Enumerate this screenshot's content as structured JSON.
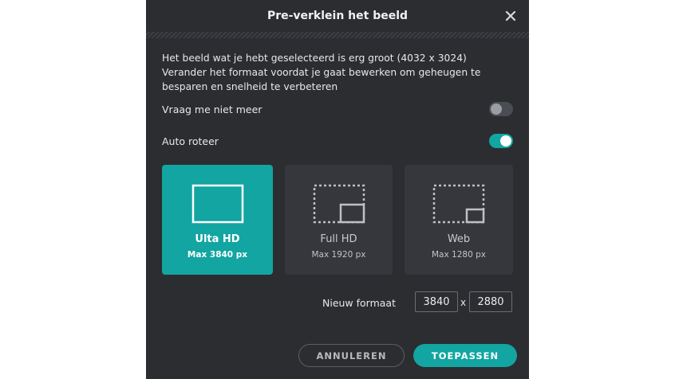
{
  "dialog": {
    "title": "Pre-verklein het beeld",
    "close_icon": "close-icon",
    "description": "Het beeld wat je hebt geselecteerd is erg groot (4032 x 3024) Verander het formaat voordat je gaat bewerken om geheugen te besparen en snelheid te verbeteren",
    "description_lines": [
      "Het beeld wat je hebt geselecteerd is erg groot (4032 x 3024)",
      "Verander het formaat voordat je gaat bewerken om geheugen te",
      "besparen en snelheid te verbeteren"
    ]
  },
  "options": {
    "dont_ask_label": "Vraag me niet meer",
    "dont_ask_on": false,
    "auto_rotate_label": "Auto roteer",
    "auto_rotate_on": true
  },
  "presets": [
    {
      "name": "Ulta HD",
      "sub": "Max 3840 px",
      "icon": "full-frame-icon",
      "selected": true
    },
    {
      "name": "Full HD",
      "sub": "Max 1920 px",
      "icon": "resize-medium-icon",
      "selected": false
    },
    {
      "name": "Web",
      "sub": "Max 1280 px",
      "icon": "resize-small-icon",
      "selected": false
    }
  ],
  "new_size": {
    "label": "Nieuw formaat",
    "width": "3840",
    "separator": "x",
    "height": "2880"
  },
  "buttons": {
    "cancel": "ANNULEREN",
    "apply": "TOEPASSEN"
  },
  "colors": {
    "accent": "#12a5a1",
    "dialog_bg": "#2b2d31",
    "card_bg": "#35373c"
  }
}
